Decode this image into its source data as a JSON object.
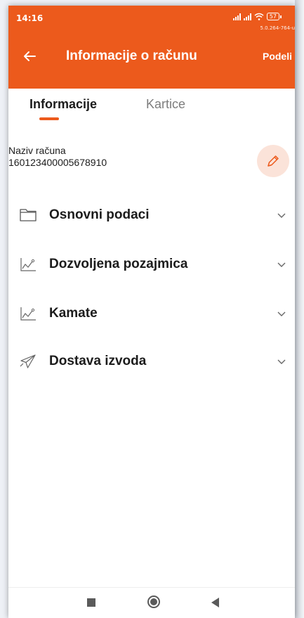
{
  "status_bar": {
    "time": "14:16",
    "battery": "57",
    "version": "5.0.264-764-ui"
  },
  "app_bar": {
    "title": "Informacije o računu",
    "share_label": "Podeli",
    "back_icon": "arrow-left-icon"
  },
  "tabs": [
    {
      "label": "Informacije",
      "active": true
    },
    {
      "label": "Kartice",
      "active": false
    }
  ],
  "account": {
    "label": "Naziv računa",
    "number": "160123400005678910",
    "edit_icon": "pencil-icon"
  },
  "sections": [
    {
      "label": "Osnovni podaci",
      "icon": "folder-icon"
    },
    {
      "label": "Dozvoljena pozajmica",
      "icon": "chart-line-icon"
    },
    {
      "label": "Kamate",
      "icon": "chart-line-icon"
    },
    {
      "label": "Dostava izvoda",
      "icon": "paper-plane-icon"
    }
  ],
  "colors": {
    "accent": "#ec5a1c",
    "accent_light": "#fbe3d9",
    "text": "#1c1c1c",
    "muted": "#7d7d7d"
  }
}
